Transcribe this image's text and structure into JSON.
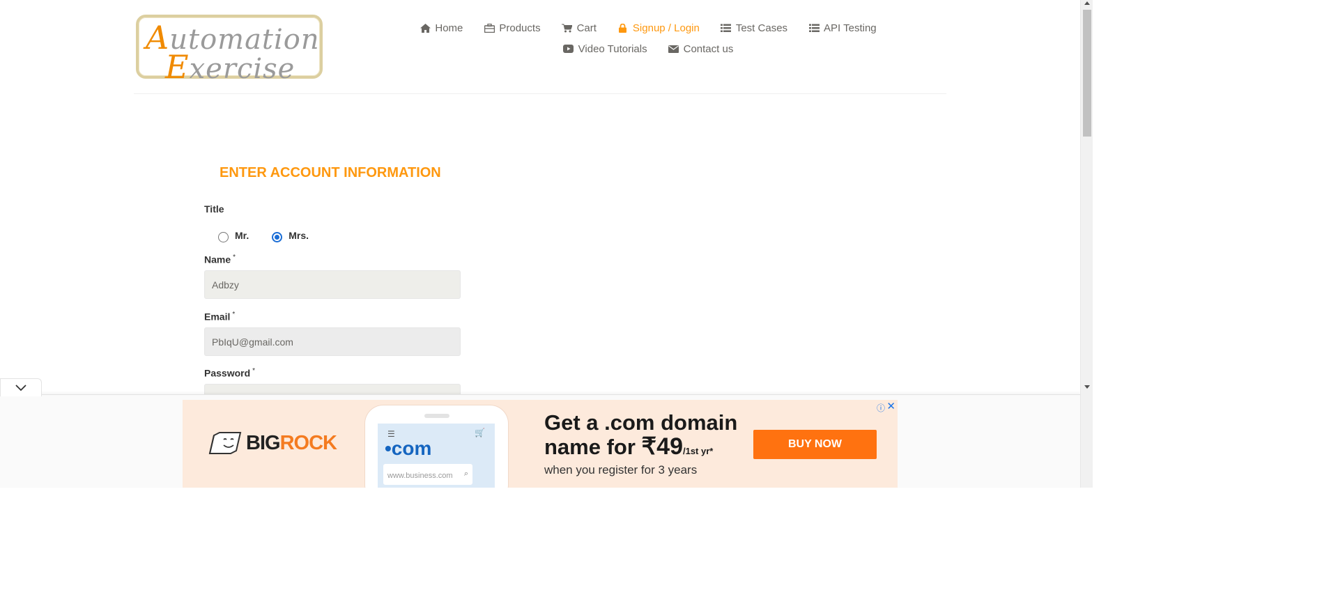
{
  "logo": {
    "line1_cap": "A",
    "line1_rest": "utomation",
    "line2_cap": "E",
    "line2_rest": "xercise"
  },
  "nav": {
    "row1": [
      {
        "label": "Home",
        "icon": "home-icon"
      },
      {
        "label": "Products",
        "icon": "briefcase-icon"
      },
      {
        "label": "Cart",
        "icon": "cart-icon"
      },
      {
        "label": "Signup / Login",
        "icon": "lock-icon",
        "active": true
      },
      {
        "label": "Test Cases",
        "icon": "list-icon"
      },
      {
        "label": "API Testing",
        "icon": "list-icon"
      }
    ],
    "row2": [
      {
        "label": "Video Tutorials",
        "icon": "youtube-play-icon"
      },
      {
        "label": "Contact us",
        "icon": "envelope-icon"
      }
    ]
  },
  "form": {
    "heading": "ENTER ACCOUNT INFORMATION",
    "title_label": "Title",
    "title_options": [
      {
        "label": "Mr.",
        "checked": false
      },
      {
        "label": "Mrs.",
        "checked": true
      }
    ],
    "name_label": "Name",
    "name_value": "Adbzy",
    "email_label": "Email",
    "email_value": "PbIqU@gmail.com",
    "password_label": "Password",
    "required_mark": "*"
  },
  "ad": {
    "brand_part1": "BIG",
    "brand_part2": "ROCK",
    "headline_line1": "Get a .com domain",
    "headline_price_prefix": "name for ",
    "headline_price": "₹49",
    "headline_price_suffix": "/1st yr*",
    "subtext": "when you register for 3 years",
    "phone_dotcom": "•com",
    "phone_search_placeholder": "www.business.com",
    "button": "BUY NOW",
    "info_icon": "ⓘ",
    "close_icon": "✕"
  },
  "colors": {
    "accent": "#fe980f",
    "ad_button": "#ff7210",
    "ad_bg": "#fdeadc",
    "radio_checked": "#1a6dd6"
  }
}
